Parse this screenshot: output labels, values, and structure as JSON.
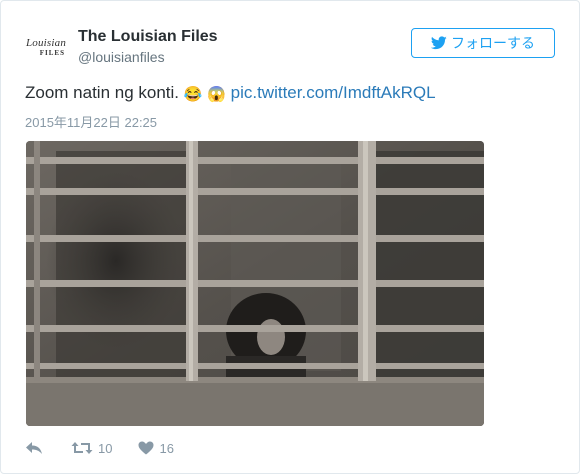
{
  "header": {
    "avatar_line1": "Louisian",
    "avatar_line2": "FILES",
    "name": "The Louisian Files",
    "handle": "@louisianfiles",
    "follow_label": "フォローする"
  },
  "tweet": {
    "text": "Zoom natin ng konti.",
    "emoji1": "😂",
    "emoji2": "😱",
    "link": "pic.twitter.com/ImdftAkRQL",
    "timestamp": "2015年11月22日 22:25"
  },
  "actions": {
    "retweet_count": "10",
    "like_count": "16"
  },
  "colors": {
    "accent": "#1da1f2",
    "link": "#2b7bb9",
    "muted": "#8899a6"
  },
  "icons": [
    "twitter-bird-icon",
    "reply-icon",
    "retweet-icon",
    "heart-icon"
  ]
}
